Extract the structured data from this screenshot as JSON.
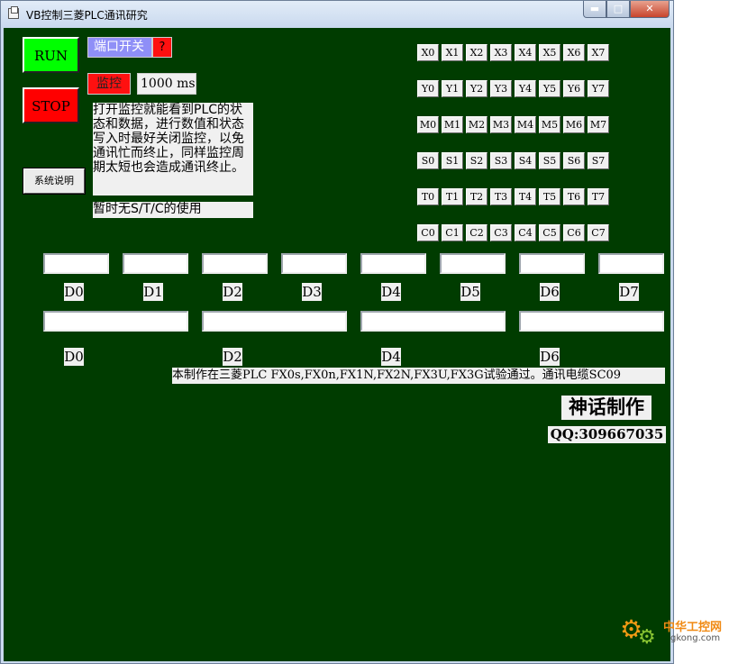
{
  "window": {
    "title": "VB控制三菱PLC通讯研究",
    "buttons": {
      "minimize": "▬",
      "maximize": "□",
      "close": "✕"
    }
  },
  "controls": {
    "run_label": "RUN",
    "stop_label": "STOP",
    "port_label": "端口开关",
    "port_status": "?",
    "monitor_label": "监控",
    "monitor_period": "1000 ms",
    "help_label": "系统说明"
  },
  "notes": {
    "description": "打开监控就能看到PLC的状态和数据，进行数值和状态写入时最好关闭监控，以免通讯忙而终止，同样监控周期太短也会造成通讯终止。",
    "stc_note": "暂时无S/T/C的使用"
  },
  "io_rows": [
    [
      "X0",
      "X1",
      "X2",
      "X3",
      "X4",
      "X5",
      "X6",
      "X7"
    ],
    [
      "Y0",
      "Y1",
      "Y2",
      "Y3",
      "Y4",
      "Y5",
      "Y6",
      "Y7"
    ],
    [
      "M0",
      "M1",
      "M2",
      "M3",
      "M4",
      "M5",
      "M6",
      "M7"
    ],
    [
      "S0",
      "S1",
      "S2",
      "S3",
      "S4",
      "S5",
      "S6",
      "S7"
    ],
    [
      "T0",
      "T1",
      "T2",
      "T3",
      "T4",
      "T5",
      "T6",
      "T7"
    ],
    [
      "C0",
      "C1",
      "C2",
      "C3",
      "C4",
      "C5",
      "C6",
      "C7"
    ]
  ],
  "d16": {
    "labels": [
      "D0",
      "D1",
      "D2",
      "D3",
      "D4",
      "D5",
      "D6",
      "D7"
    ],
    "values": [
      "",
      "",
      "",
      "",
      "",
      "",
      "",
      ""
    ]
  },
  "d32": {
    "labels": [
      "D0",
      "D2",
      "D4",
      "D6"
    ],
    "values": [
      "",
      "",
      "",
      ""
    ]
  },
  "footer": {
    "compat": "本制作在三菱PLC FX0s,FX0n,FX1N,FX2N,FX3U,FX3G试验通过。通讯电缆SC09",
    "author": "神话制作",
    "qq": "QQ:309667035"
  },
  "watermark": {
    "name": "中华工控网",
    "domain": "gkong.com"
  }
}
